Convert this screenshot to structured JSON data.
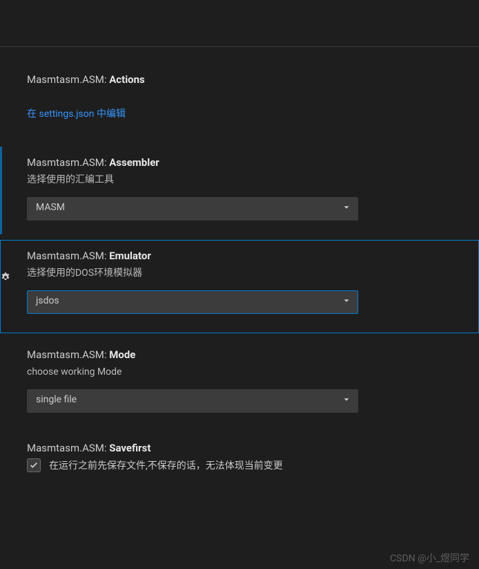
{
  "settings": {
    "actions": {
      "prefix": "Masmtasm.ASM: ",
      "name": "Actions",
      "editLink": "在 settings.json 中编辑"
    },
    "assembler": {
      "prefix": "Masmtasm.ASM: ",
      "name": "Assembler",
      "description": "选择使用的汇编工具",
      "value": "MASM"
    },
    "emulator": {
      "prefix": "Masmtasm.ASM: ",
      "name": "Emulator",
      "description": "选择使用的DOS环境模拟器",
      "value": "jsdos"
    },
    "mode": {
      "prefix": "Masmtasm.ASM: ",
      "name": "Mode",
      "description": "choose working Mode",
      "value": "single file"
    },
    "savefirst": {
      "prefix": "Masmtasm.ASM: ",
      "name": "Savefirst",
      "label": "在运行之前先保存文件,不保存的话，无法体现当前变更"
    }
  },
  "watermark": "CSDN @小_煜同学"
}
